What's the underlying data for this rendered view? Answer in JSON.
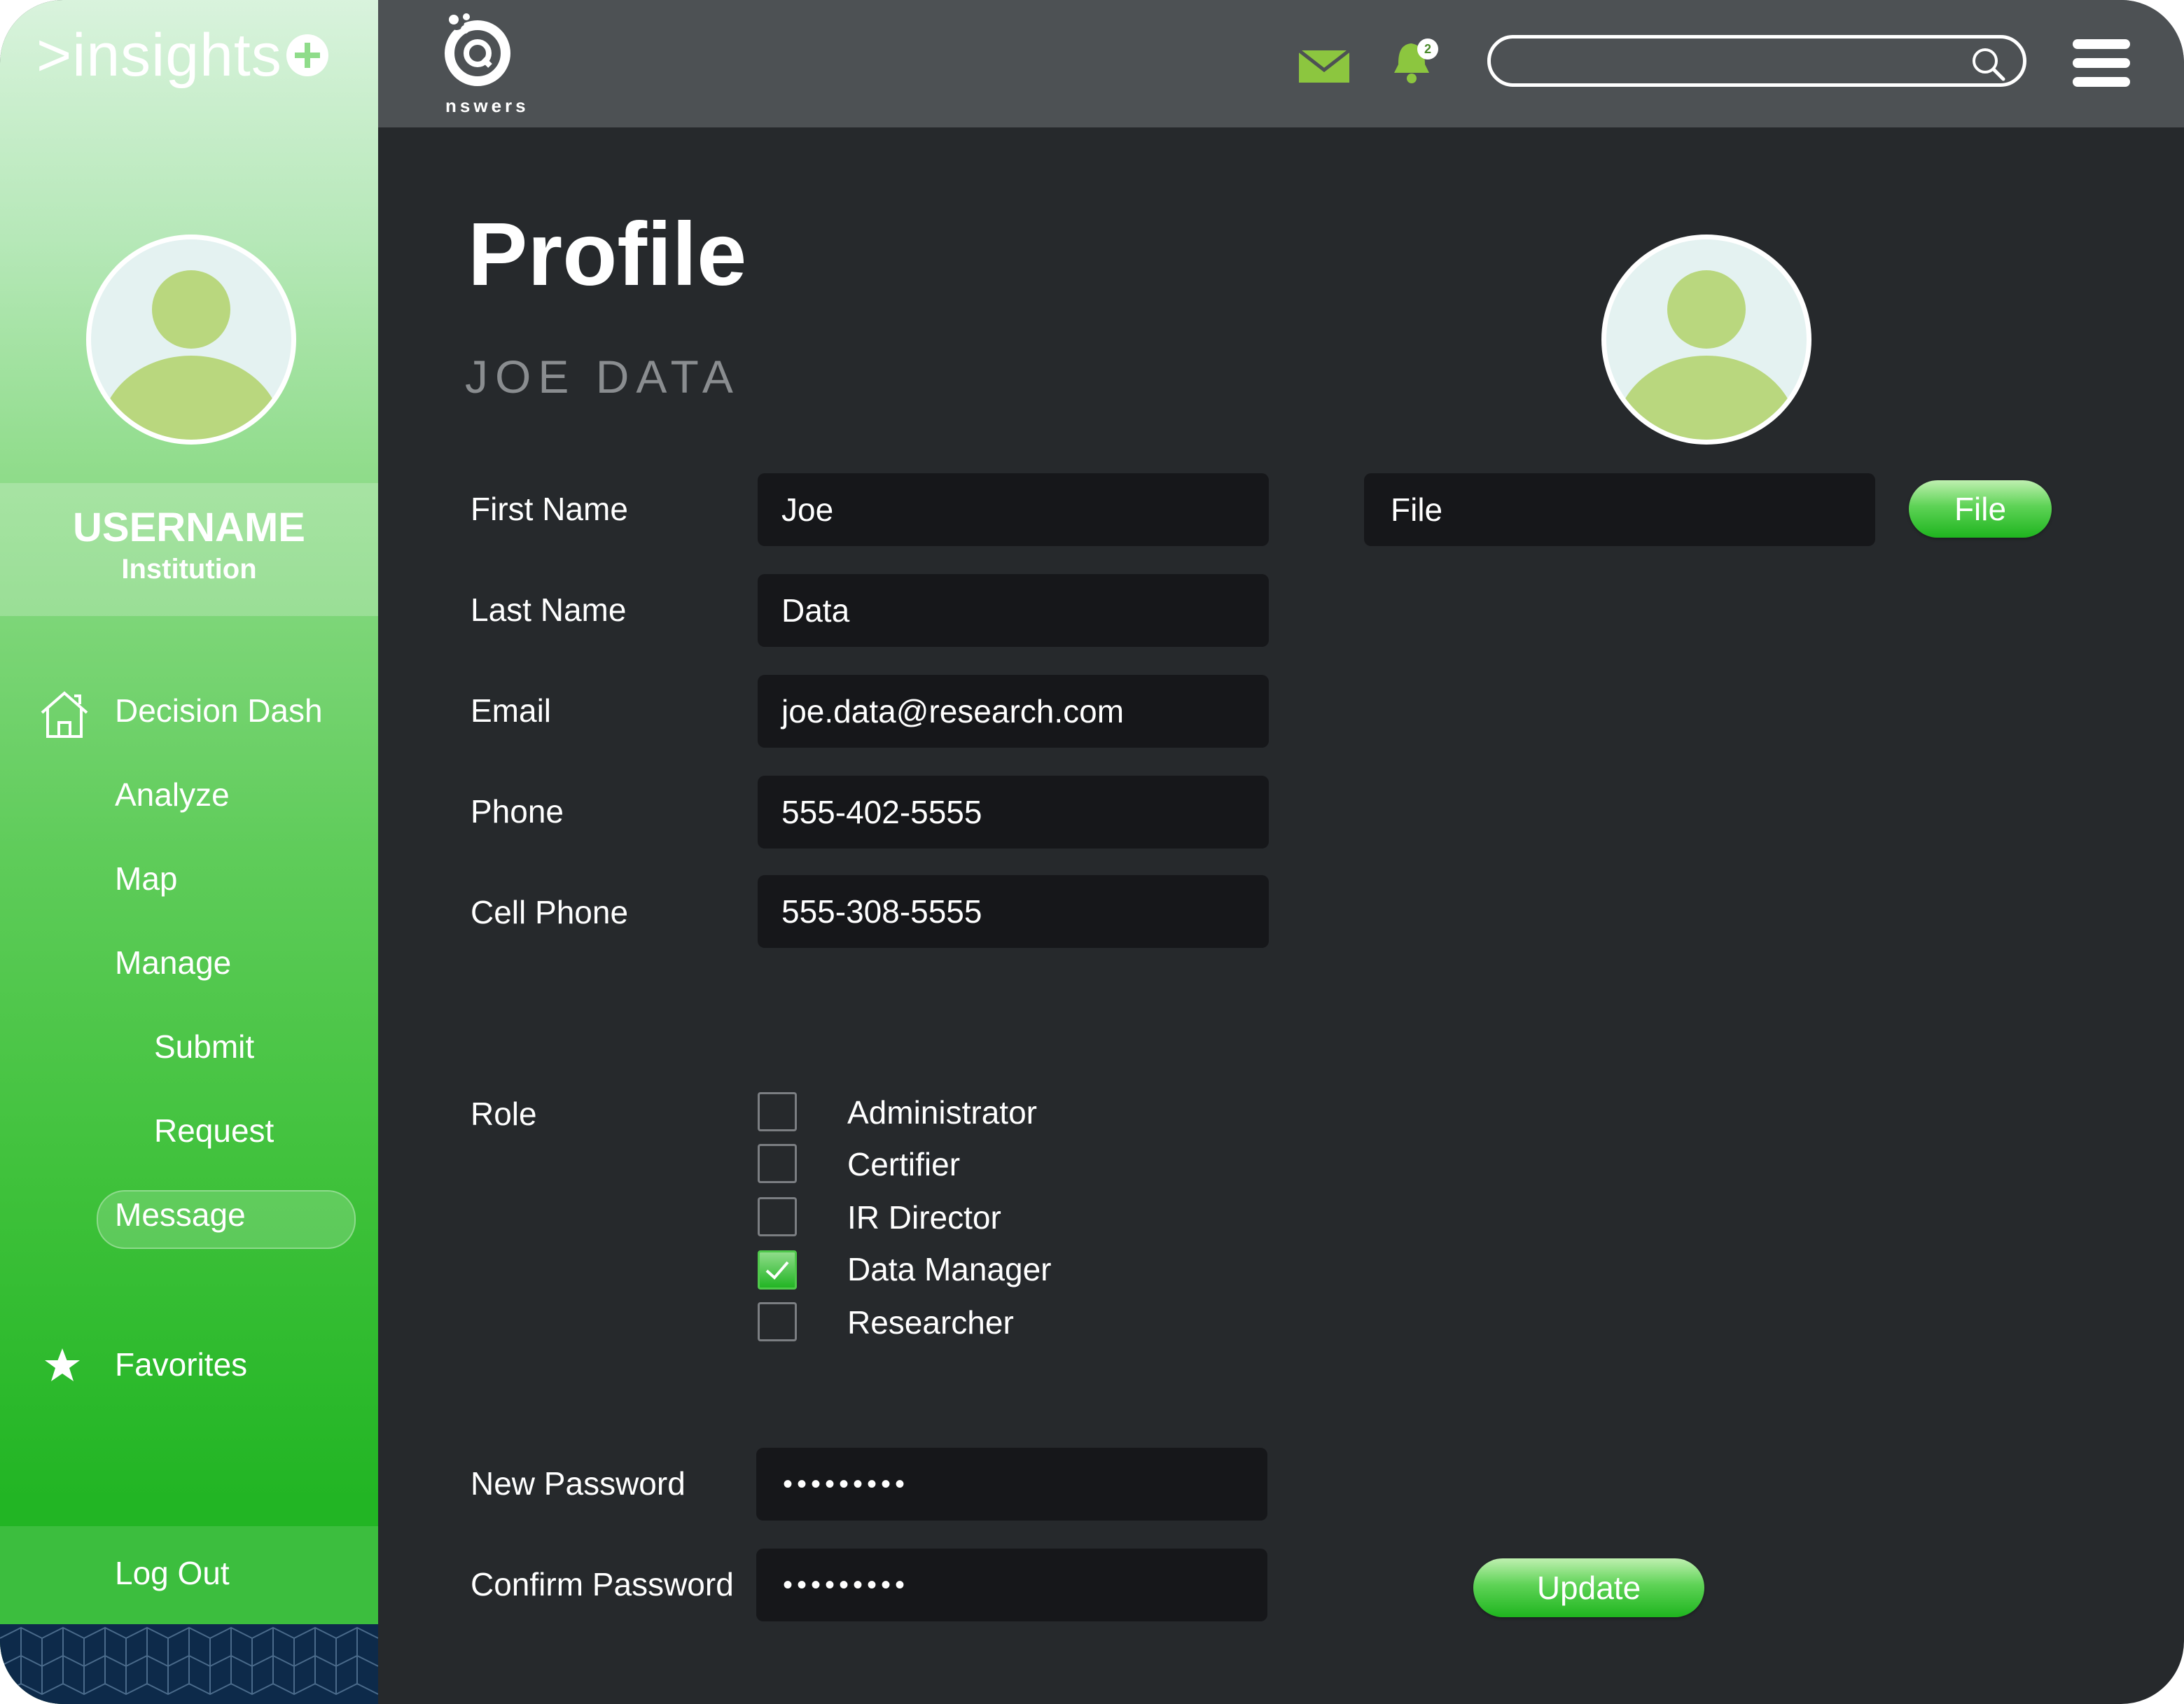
{
  "sidebar": {
    "brand": ">insights",
    "username": "USERNAME",
    "institution": "Institution",
    "items": [
      {
        "label": "Decision Dash",
        "icon": "home-icon"
      },
      {
        "label": "Analyze"
      },
      {
        "label": "Map"
      },
      {
        "label": "Manage"
      },
      {
        "label": "Submit"
      },
      {
        "label": "Request"
      },
      {
        "label": "Message",
        "selected": true
      },
      {
        "label": "Favorites",
        "icon": "star-icon"
      }
    ],
    "logout": "Log Out"
  },
  "header": {
    "logo_text": "nswers",
    "notification_count": "2",
    "search_placeholder": ""
  },
  "page": {
    "title": "Profile",
    "subtitle": "JOE DATA"
  },
  "form": {
    "fields": [
      {
        "label": "First Name",
        "value": "Joe"
      },
      {
        "label": "Last Name",
        "value": "Data"
      },
      {
        "label": "Email",
        "value": "joe.data@research.com"
      },
      {
        "label": "Phone",
        "value": "555-402-5555"
      },
      {
        "label": "Cell Phone",
        "value": "555-308-5555"
      }
    ],
    "file_field": "File",
    "file_button": "File",
    "role_label": "Role",
    "roles": [
      {
        "label": "Administrator",
        "checked": false
      },
      {
        "label": "Certifier",
        "checked": false
      },
      {
        "label": "IR Director",
        "checked": false
      },
      {
        "label": "Data Manager",
        "checked": true
      },
      {
        "label": "Researcher",
        "checked": false
      }
    ],
    "new_password_label": "New Password",
    "new_password_value": "•••••••••",
    "confirm_password_label": "Confirm Password",
    "confirm_password_value": "•••••••••",
    "update_button": "Update"
  },
  "colors": {
    "accent_green": "#22b524",
    "icon_green": "#8cc63f",
    "header_bg": "#4d5154",
    "main_bg": "#26292c",
    "field_bg": "#16171a"
  }
}
